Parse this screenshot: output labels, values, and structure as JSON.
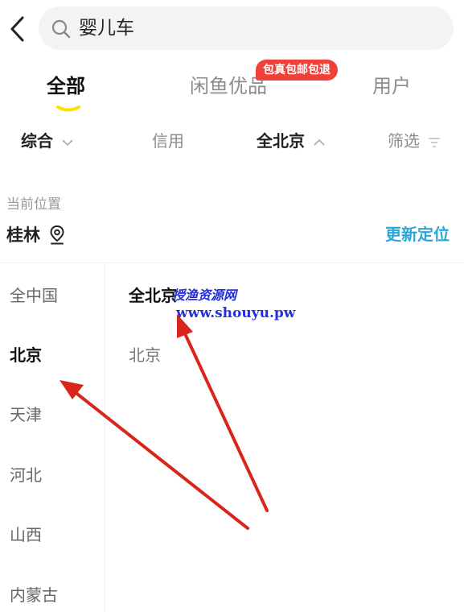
{
  "search": {
    "query": "婴儿车"
  },
  "tabs": [
    {
      "label": "全部",
      "active": true
    },
    {
      "label": "闲鱼优品",
      "active": false
    },
    {
      "label": "用户",
      "active": false
    }
  ],
  "promo_badge": "包真包邮包退",
  "filters": [
    {
      "label": "综合",
      "icon": "chevron-down-icon"
    },
    {
      "label": "信用"
    },
    {
      "label": "全北京",
      "icon": "chevron-up-icon"
    },
    {
      "label": "筛选",
      "icon": "filter-icon"
    }
  ],
  "location": {
    "label": "当前位置",
    "city": "桂林",
    "update_label": "更新定位"
  },
  "provinces": [
    "全中国",
    "北京",
    "天津",
    "河北",
    "山西",
    "内蒙古"
  ],
  "selected_province": "北京",
  "cities": [
    "全北京",
    "北京"
  ],
  "selected_city": "全北京",
  "watermark": {
    "line1": "授渔资源网",
    "line2": "www.shouyu.pw"
  },
  "colors": {
    "accent_yellow": "#ffe000",
    "badge_red": "#f0403a",
    "link_blue": "#2aa7d6",
    "arrow_red": "#d9261c",
    "watermark_blue": "#2430d8"
  }
}
